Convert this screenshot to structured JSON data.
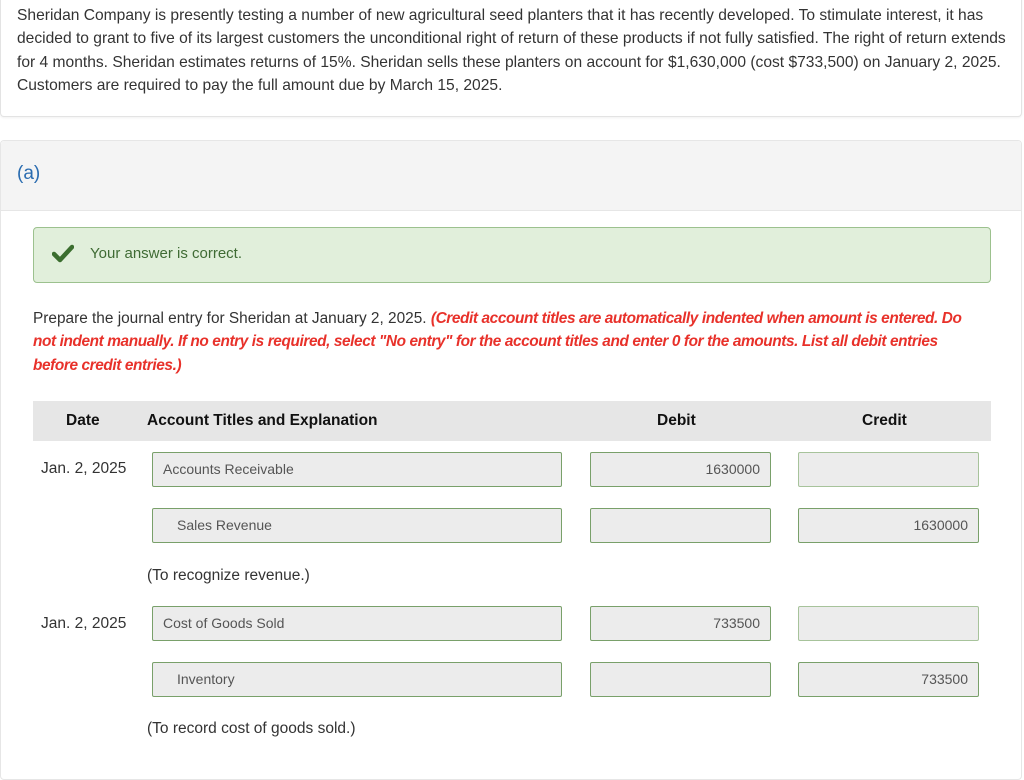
{
  "problem": {
    "text": "Sheridan Company is presently testing a number of new agricultural seed planters that it has recently developed. To stimulate interest, it has decided to grant to five of its largest customers the unconditional right of return of these products if not fully satisfied. The right of return extends for 4 months. Sheridan estimates returns of 15%. Sheridan sells these planters on account for $1,630,000 (cost $733,500) on January 2, 2025. Customers are required to pay the full amount due by March 15, 2025."
  },
  "part": {
    "label": "(a)",
    "feedback": {
      "icon": "checkmark-icon",
      "text": "Your answer is correct.",
      "color": "#3f6b34"
    },
    "instruction_plain": "Prepare the journal entry for Sheridan at January 2, 2025. ",
    "instruction_red": "(Credit account titles are automatically indented when amount is entered. Do not indent manually. If no entry is required, select \"No entry\" for the account titles and enter 0 for the amounts. List all debit entries before credit entries.)",
    "table": {
      "headers": {
        "date": "Date",
        "account": "Account Titles and Explanation",
        "debit": "Debit",
        "credit": "Credit"
      },
      "entries": [
        {
          "date": "Jan. 2, 2025",
          "lines": [
            {
              "account": "Accounts Receivable",
              "debit": "1630000",
              "credit": ""
            },
            {
              "account": "Sales Revenue",
              "debit": "",
              "credit": "1630000"
            }
          ],
          "explanation": "(To recognize revenue.)"
        },
        {
          "date": "Jan. 2, 2025",
          "lines": [
            {
              "account": "Cost of Goods Sold",
              "debit": "733500",
              "credit": ""
            },
            {
              "account": "Inventory",
              "debit": "",
              "credit": "733500"
            }
          ],
          "explanation": "(To record cost of goods sold.)"
        }
      ]
    }
  },
  "colors": {
    "accent_blue": "#2a6cb0",
    "instruction_red": "#e8312a",
    "success_bg": "#e1efdb",
    "success_border": "#9cc18e",
    "field_border": "#79a06a"
  }
}
